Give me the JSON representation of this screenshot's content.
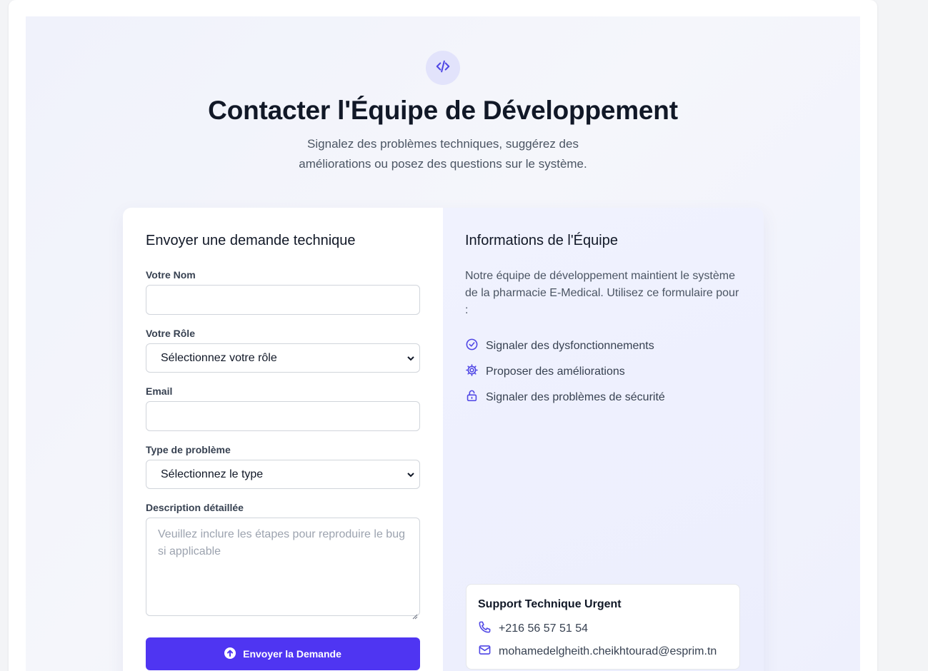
{
  "hero": {
    "title": "Contacter l'Équipe de Développement",
    "subtitle": "Signalez des problèmes techniques, suggérez des améliorations ou posez des questions sur le système.",
    "icon": "code-icon"
  },
  "form": {
    "title": "Envoyer une demande technique",
    "name_label": "Votre Nom",
    "name_value": "",
    "role_label": "Votre Rôle",
    "role_selected": "Sélectionnez votre rôle",
    "email_label": "Email",
    "email_value": "",
    "type_label": "Type de problème",
    "type_selected": "Sélectionnez le type",
    "description_label": "Description détaillée",
    "description_placeholder": "Veuillez inclure les étapes pour reproduire le bug si applicable",
    "submit_label": "Envoyer la Demande",
    "submit_icon": "arrow-up-circle-icon"
  },
  "info": {
    "title": "Informations de l'Équipe",
    "description": "Notre équipe de développement maintient le système de la pharmacie E-Medical. Utilisez ce formulaire pour :",
    "features": [
      {
        "icon": "check-circle-icon",
        "label": "Signaler des dysfonctionnements"
      },
      {
        "icon": "gear-icon",
        "label": "Proposer des améliorations"
      },
      {
        "icon": "lock-icon",
        "label": "Signaler des problèmes de sécurité"
      }
    ],
    "support": {
      "title": "Support Technique Urgent",
      "phone": "+216 56 57 51 54",
      "email": "mohamedelgheith.cheikhtourad@esprim.tn"
    }
  },
  "colors": {
    "accent": "#4f35f2",
    "icon": "#4f46e5",
    "badge_bg": "#e2e3fb"
  }
}
